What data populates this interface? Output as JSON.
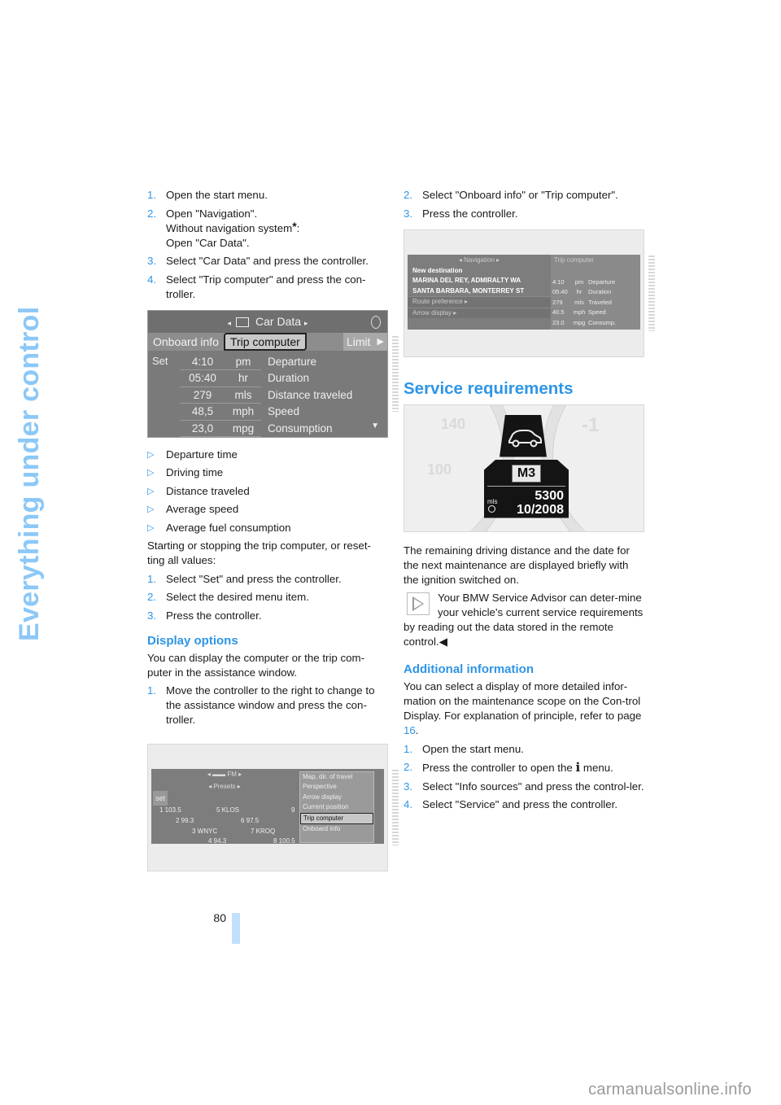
{
  "side_title": "Everything under control",
  "left": {
    "steps_a": [
      {
        "num": "1.",
        "text": "Open the start menu."
      },
      {
        "num": "2.",
        "lines": [
          "Open \"Navigation\".",
          "Without navigation system",
          ":",
          "Open \"Car Data\"."
        ]
      },
      {
        "num": "3.",
        "text": "Select \"Car Data\" and press the controller."
      },
      {
        "num": "4.",
        "text": "Select \"Trip computer\" and press the con-troller."
      }
    ],
    "asterisk": "*",
    "car_data_screen": {
      "title": "Car Data",
      "arrow_left": "◂",
      "arrow_right": "▸",
      "tabs": [
        "Onboard info",
        "Trip computer",
        "Limit",
        "▶"
      ],
      "set_label": "Set",
      "rows": [
        {
          "value": "4:10",
          "unit": "pm",
          "label": "Departure"
        },
        {
          "value": "05:40",
          "unit": "hr",
          "label": "Duration"
        },
        {
          "value": "279",
          "unit": "mls",
          "label": "Distance traveled"
        },
        {
          "value": "48,5",
          "unit": "mph",
          "label": "Speed"
        },
        {
          "value": "23,0",
          "unit": "mpg",
          "label": "Consumption"
        }
      ],
      "scroll_marker": "▼"
    },
    "bullets": [
      "Departure time",
      "Driving time",
      "Distance traveled",
      "Average speed",
      "Average fuel consumption"
    ],
    "bullet_marker": "▷",
    "reset_intro": "Starting or stopping the trip computer, or reset-ting all values:",
    "steps_b": [
      {
        "num": "1.",
        "text": "Select \"Set\" and press the controller."
      },
      {
        "num": "2.",
        "text": "Select the desired menu item."
      },
      {
        "num": "3.",
        "text": "Press the controller."
      }
    ],
    "display_options": {
      "heading": "Display options",
      "intro": "You can display the computer or the trip com-puter in the assistance window.",
      "steps": [
        {
          "num": "1.",
          "text": "Move the controller to the right to change to the assistance window and press the con-troller."
        }
      ]
    },
    "assist_screen": {
      "header": "◂ ▬▬ FM ▸",
      "sub": "◂ Presets ▸",
      "set_label": "set",
      "presets": [
        "1 103.5",
        "5 KLOS",
        "2 99.3",
        "6 97.5",
        "3 WNYC",
        "7 KROQ",
        "4 94.3",
        "8 100.5",
        "9"
      ],
      "menu_items": [
        "Map, dir. of travel",
        "Perspective",
        "Arrow display",
        "Current position",
        "Trip computer",
        "Onboard info"
      ],
      "selected_menu": "Trip computer"
    }
  },
  "right": {
    "steps": [
      {
        "num": "2.",
        "text": "Select \"Onboard info\" or \"Trip computer\"."
      },
      {
        "num": "3.",
        "text": "Press the controller."
      }
    ],
    "nav_screen": {
      "header": "◂ Navigation ▸",
      "items": [
        "New destination",
        "MARINA DEL REY, ADMIRALTY WA",
        "SANTA BARBARA, MONTERREY ST"
      ],
      "dim_items": [
        "Route preference ▸",
        "Arrow display ▸"
      ],
      "trip_header": "Trip computer",
      "trip_rows": [
        {
          "value": "4:10",
          "unit": "pm",
          "label": "Departure"
        },
        {
          "value": "05:40",
          "unit": "hr",
          "label": "Duration"
        },
        {
          "value": "279",
          "unit": "mls",
          "label": "Traveled"
        },
        {
          "value": "40.5",
          "unit": "mph",
          "label": "Speed"
        },
        {
          "value": "23.0",
          "unit": "mpg",
          "label": "Consump."
        }
      ]
    },
    "service": {
      "heading": "Service requirements",
      "display": {
        "model": "M3",
        "unit": "mls",
        "distance": "5300",
        "date": "10/2008"
      },
      "gauge_labels": [
        "140",
        "100",
        "-1"
      ],
      "body": "The remaining driving distance and the date for the next maintenance are displayed briefly with the ignition switched on.",
      "note": "Your BMW Service Advisor can deter-mine your vehicle's current service requirements by reading out the data stored in the remote control.",
      "note_end": "◀"
    },
    "additional": {
      "heading": "Additional information",
      "intro_a": "You can select a display of more detailed infor-mation on the maintenance scope on the Con-trol Display. For explanation of principle, refer to page ",
      "page_link": "16",
      "intro_b": ".",
      "steps": [
        {
          "num": "1.",
          "text": "Open the start menu."
        },
        {
          "num": "2.",
          "text_a": "Press the controller to open the ",
          "icon": "i",
          "text_b": " menu."
        },
        {
          "num": "3.",
          "text": "Select \"Info sources\" and press the control-ler."
        },
        {
          "num": "4.",
          "text": "Select \"Service\" and press the controller."
        }
      ]
    }
  },
  "page_number": "80",
  "watermark": "carmanualsonline.info"
}
